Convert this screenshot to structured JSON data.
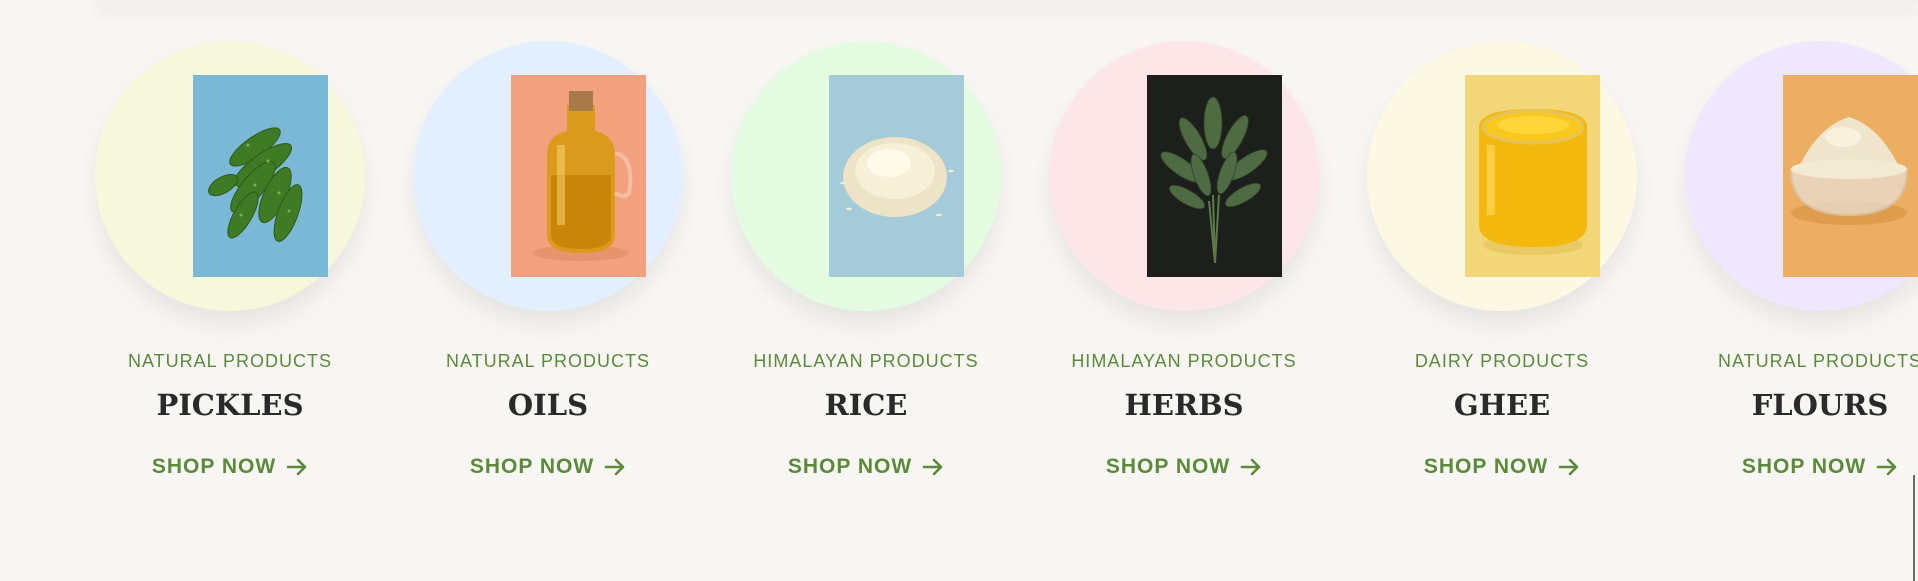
{
  "cards": [
    {
      "category": "NATURAL PRODUCTS",
      "title": "PICKLES",
      "cta": "SHOP NOW",
      "circle_color": "#f6f8dc",
      "photo_bg": "#7bb8d6",
      "icon": "pickles-photo"
    },
    {
      "category": "NATURAL PRODUCTS",
      "title": "OILS",
      "cta": "SHOP NOW",
      "circle_color": "#e3efff",
      "photo_bg": "#f2a07e",
      "icon": "oil-bottle-photo"
    },
    {
      "category": "HIMALAYAN PRODUCTS",
      "title": "RICE",
      "cta": "SHOP NOW",
      "circle_color": "#e4fbe2",
      "photo_bg": "#a6cbd8",
      "icon": "rice-photo"
    },
    {
      "category": "HIMALAYAN PRODUCTS",
      "title": "HERBS",
      "cta": "SHOP NOW",
      "circle_color": "#fde6e8",
      "photo_bg": "#1c1f1c",
      "icon": "herbs-photo"
    },
    {
      "category": "DAIRY PRODUCTS",
      "title": "GHEE",
      "cta": "SHOP NOW",
      "circle_color": "#fdf8e3",
      "photo_bg": "#f2d778",
      "icon": "ghee-jar-photo"
    },
    {
      "category": "NATURAL PRODUCTS",
      "title": "FLOURS",
      "cta": "SHOP NOW",
      "circle_color": "#efe6ff",
      "photo_bg": "#ecae62",
      "icon": "flour-bowl-photo"
    }
  ],
  "colors": {
    "accent": "#5b8a3c",
    "title": "#2a2a2a",
    "page_bg": "#f8f6f2"
  }
}
